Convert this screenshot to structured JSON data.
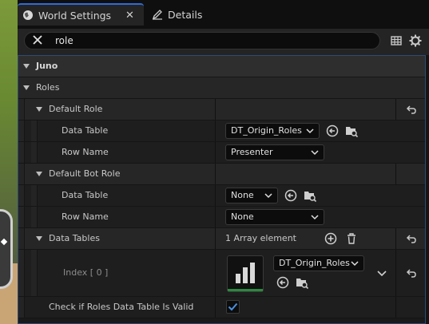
{
  "tabs": [
    {
      "label": "World Settings",
      "icon": "globe-icon",
      "active": true
    },
    {
      "label": "Details",
      "icon": "edit-icon",
      "active": false
    }
  ],
  "close_glyph": "✕",
  "search": {
    "value": "role"
  },
  "sections": {
    "juno": "Juno",
    "roles": "Roles",
    "default_role": "Default Role",
    "default_role_data_table_label": "Data Table",
    "default_role_data_table_value": "DT_Origin_Roles",
    "default_role_row_name_label": "Row Name",
    "default_role_row_name_value": "Presenter",
    "default_bot_role": "Default Bot Role",
    "bot_data_table_label": "Data Table",
    "bot_data_table_value": "None",
    "bot_row_name_label": "Row Name",
    "bot_row_name_value": "None",
    "data_tables": "Data Tables",
    "data_tables_count": "1 Array element",
    "index_label": "Index [ 0 ]",
    "index_value": "DT_Origin_Roles",
    "check_label": "Check if Roles Data Table Is Valid",
    "check_value": true
  },
  "colors": {
    "accent": "#2f6bd8",
    "check": "#4a90e2",
    "thumb_base": "#2b8a3e"
  }
}
